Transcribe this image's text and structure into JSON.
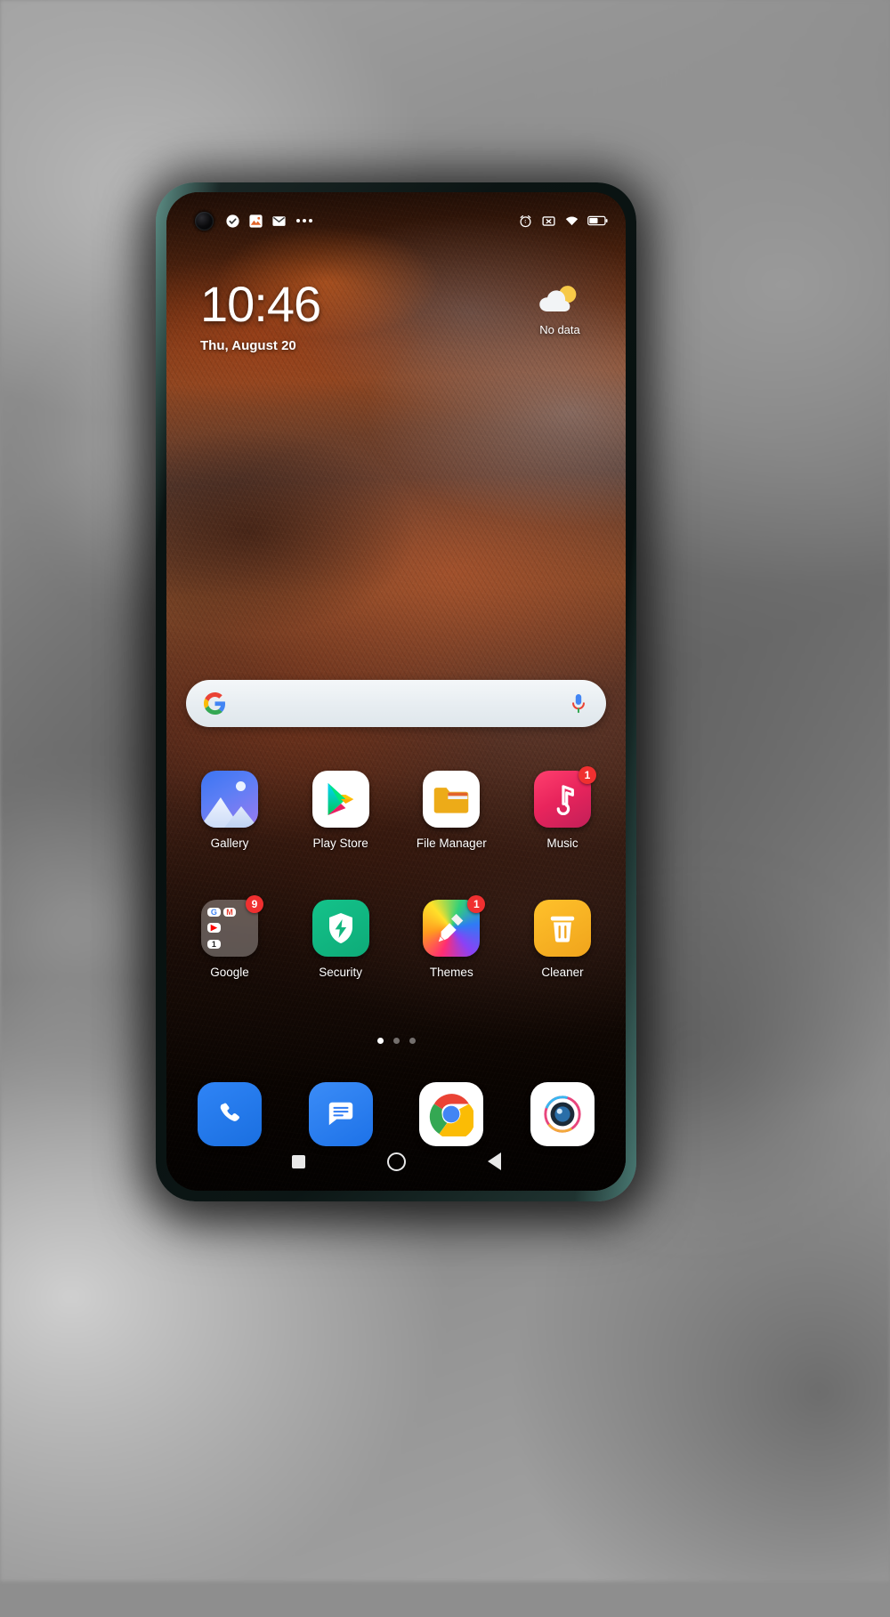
{
  "device": {
    "type": "smartphone",
    "os": "MIUI Android home screen"
  },
  "status_bar": {
    "left_icons": [
      "checkmark-badge-icon",
      "photo-app-icon",
      "gmail-icon",
      "more-notifications-icon"
    ],
    "right_icons": [
      "alarm-icon",
      "silent-mode-icon",
      "wifi-icon",
      "battery-icon"
    ]
  },
  "clock_widget": {
    "time": "10:46",
    "date": "Thu, August 20"
  },
  "weather_widget": {
    "icon": "sun-behind-cloud-icon",
    "label": "No data"
  },
  "search": {
    "logo": "google-g-icon",
    "mic": "microphone-icon",
    "placeholder": ""
  },
  "apps": {
    "row1": [
      {
        "label": "Gallery",
        "icon": "gallery-icon",
        "badge": ""
      },
      {
        "label": "Play Store",
        "icon": "play-store-icon",
        "badge": ""
      },
      {
        "label": "File Manager",
        "icon": "file-manager-icon",
        "badge": ""
      },
      {
        "label": "Music",
        "icon": "music-icon",
        "badge": "1"
      }
    ],
    "row2": [
      {
        "label": "Google",
        "icon": "google-folder-icon",
        "badge": "9"
      },
      {
        "label": "Security",
        "icon": "security-icon",
        "badge": ""
      },
      {
        "label": "Themes",
        "icon": "themes-icon",
        "badge": "1"
      },
      {
        "label": "Cleaner",
        "icon": "cleaner-icon",
        "badge": ""
      }
    ]
  },
  "google_folder_apps": [
    "G",
    "M",
    "●",
    "▶",
    "■",
    "■",
    "1"
  ],
  "page_indicator": {
    "total": 3,
    "active": 1
  },
  "dock": [
    {
      "label": "Phone",
      "icon": "phone-icon"
    },
    {
      "label": "Messages",
      "icon": "messages-icon"
    },
    {
      "label": "Chrome",
      "icon": "chrome-icon"
    },
    {
      "label": "Camera",
      "icon": "camera-icon"
    }
  ],
  "nav_bar": [
    {
      "name": "recents-button",
      "icon": "square-icon"
    },
    {
      "name": "home-button",
      "icon": "circle-icon"
    },
    {
      "name": "back-button",
      "icon": "triangle-icon"
    }
  ],
  "colors": {
    "badge_red": "#f03030",
    "accent_blue": "#2f84f6",
    "search_bg": "#e9eff3"
  }
}
